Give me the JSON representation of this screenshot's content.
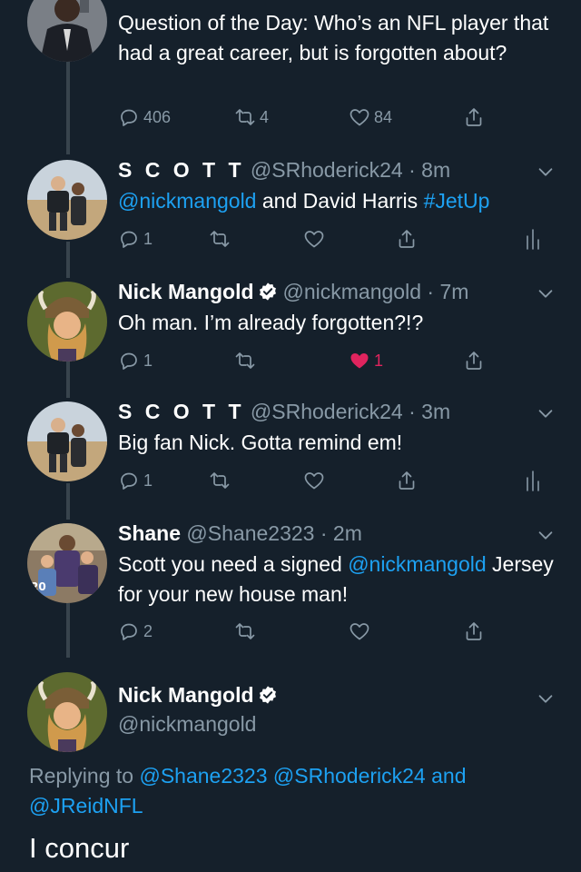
{
  "colors": {
    "background": "#15202b",
    "link": "#1da1f2",
    "secondary_text": "#8899a6",
    "like_red": "#e0245e",
    "thread_line": "#38444d"
  },
  "top_tweet": {
    "text": "Question of the Day: Who’s an NFL player that had a great career, but is forgotten about?",
    "replies": "406",
    "retweets": "4",
    "likes": "84"
  },
  "replies": [
    {
      "name": "S C O T T",
      "handle": "@SRhoderick24",
      "time": "8m",
      "text_parts": [
        {
          "text": "@nickmangold",
          "link": true
        },
        {
          "text": " and David Harris ",
          "link": false
        },
        {
          "text": "#JetUp",
          "link": true
        }
      ],
      "reply_count": "1",
      "retweet_count": "",
      "like_count": "",
      "liked": false,
      "avatar_icon": "couple-beach-avatar"
    },
    {
      "name": "Nick Mangold",
      "verified": true,
      "handle": "@nickmangold",
      "time": "7m",
      "text_parts": [
        {
          "text": "Oh man. I’m already forgotten?!?",
          "link": false
        }
      ],
      "reply_count": "1",
      "retweet_count": "",
      "like_count": "1",
      "liked": true,
      "avatar_icon": "viking-child-avatar"
    },
    {
      "name": "S C O T T",
      "handle": "@SRhoderick24",
      "time": "3m",
      "text_parts": [
        {
          "text": "Big fan Nick. Gotta remind em!",
          "link": false
        }
      ],
      "reply_count": "1",
      "retweet_count": "",
      "like_count": "",
      "liked": false,
      "avatar_icon": "couple-beach-avatar"
    },
    {
      "name": "Shane",
      "handle": "@Shane2323",
      "time": "2m",
      "text_parts": [
        {
          "text": "Scott you need a signed ",
          "link": false
        },
        {
          "text": "@nickmangold",
          "link": true
        },
        {
          "text": " Jersey for your new house man!",
          "link": false
        }
      ],
      "reply_count": "2",
      "retweet_count": "",
      "like_count": "",
      "liked": false,
      "avatar_icon": "family-photo-avatar"
    }
  ],
  "focus_tweet": {
    "name": "Nick Mangold",
    "handle": "@nickmangold",
    "replying_prefix": "Replying to",
    "replying_mentions": [
      "@Shane2323",
      "@SRhoderick24"
    ],
    "replying_and": "and",
    "replying_last": "@JReidNFL",
    "text": "I concur"
  }
}
